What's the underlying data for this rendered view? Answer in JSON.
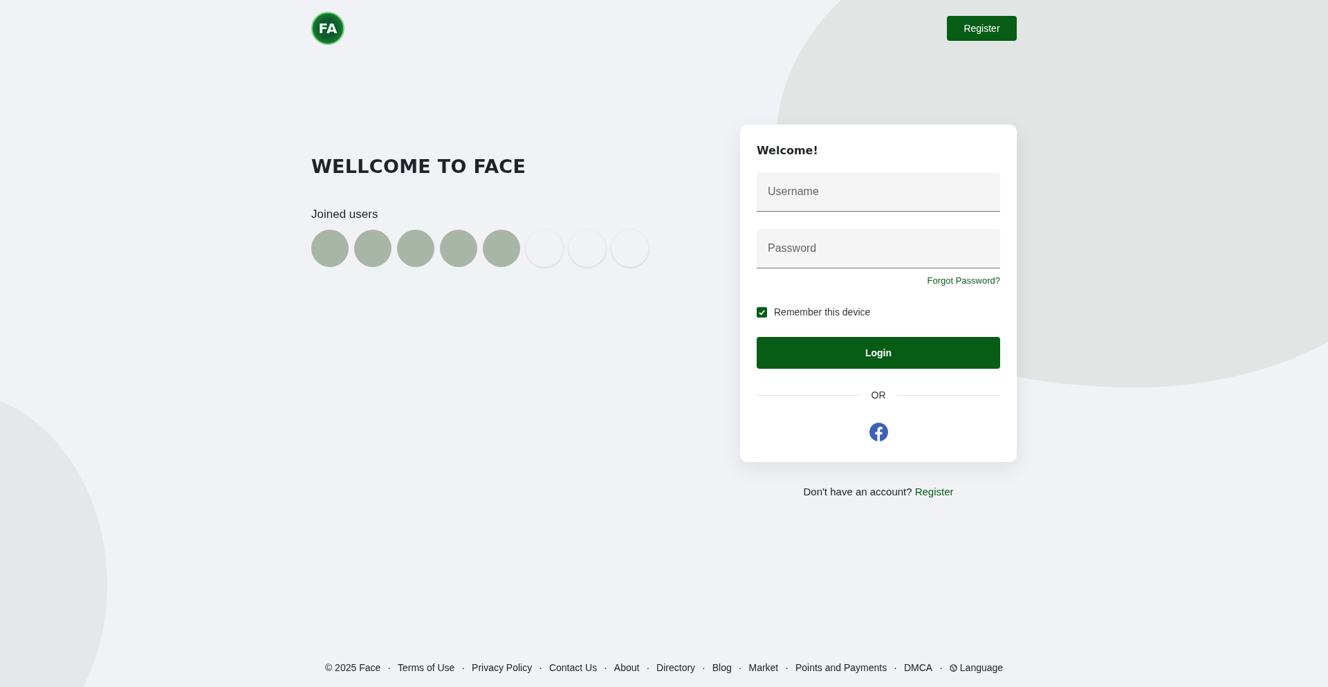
{
  "header": {
    "logo_text": "FA",
    "register_button": "Register"
  },
  "intro": {
    "title": "WELLCOME TO FACE",
    "joined_label": "Joined users",
    "avatars": [
      {
        "kind": "photo"
      },
      {
        "kind": "photo"
      },
      {
        "kind": "photo"
      },
      {
        "kind": "photo"
      },
      {
        "kind": "photo"
      },
      {
        "kind": "blank"
      },
      {
        "kind": "blank"
      },
      {
        "kind": "blank"
      }
    ]
  },
  "login": {
    "title": "Welcome!",
    "username": {
      "placeholder": "Username"
    },
    "password": {
      "placeholder": "Password"
    },
    "forgot_link": "Forgot Password?",
    "remember": {
      "label": "Remember this device",
      "checked": true
    },
    "login_button": "Login",
    "divider": "OR"
  },
  "signup": {
    "prompt": "Don't have an account?",
    "link": "Register"
  },
  "footer": {
    "separator": "·",
    "links": [
      {
        "label": "© 2025 Face",
        "kind": "text"
      },
      {
        "label": "Terms of Use",
        "kind": "link"
      },
      {
        "label": "Privacy Policy",
        "kind": "link"
      },
      {
        "label": "Contact Us",
        "kind": "link"
      },
      {
        "label": "About",
        "kind": "link"
      },
      {
        "label": "Directory",
        "kind": "link"
      },
      {
        "label": "Blog",
        "kind": "link"
      },
      {
        "label": "Market",
        "kind": "link"
      },
      {
        "label": "Points and Payments",
        "kind": "link"
      },
      {
        "label": "DMCA",
        "kind": "link"
      },
      {
        "label": "Language",
        "kind": "language"
      }
    ]
  }
}
